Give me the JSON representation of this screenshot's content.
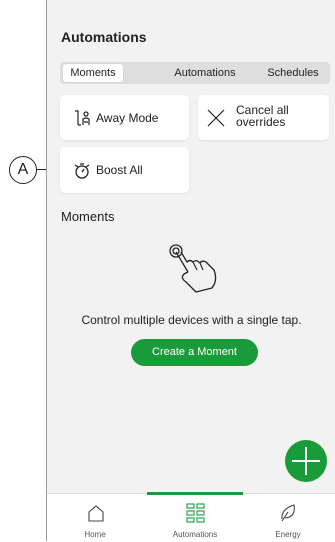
{
  "header": {
    "title": "Automations"
  },
  "tabs": [
    {
      "label": "Moments",
      "active": true
    },
    {
      "label": "Automations",
      "active": false
    },
    {
      "label": "Schedules",
      "active": false
    }
  ],
  "cards": [
    {
      "label": "Away Mode",
      "icon": "away-person-icon"
    },
    {
      "label_line1": "Cancel all",
      "label_line2": "overrides",
      "icon": "close-icon"
    },
    {
      "label": "Boost All",
      "icon": "boost-timer-icon"
    }
  ],
  "moments": {
    "section_title": "Moments",
    "description": "Control multiple devices with a single tap.",
    "create_button": "Create a Moment"
  },
  "callout": {
    "label": "A"
  },
  "nav": [
    {
      "label": "Home",
      "icon": "home-icon"
    },
    {
      "label": "Automations",
      "icon": "automations-grid-icon",
      "active": true
    },
    {
      "label": "Energy",
      "icon": "leaf-icon"
    }
  ],
  "colors": {
    "accent": "#1a9b39",
    "background": "#f2f2f2"
  }
}
